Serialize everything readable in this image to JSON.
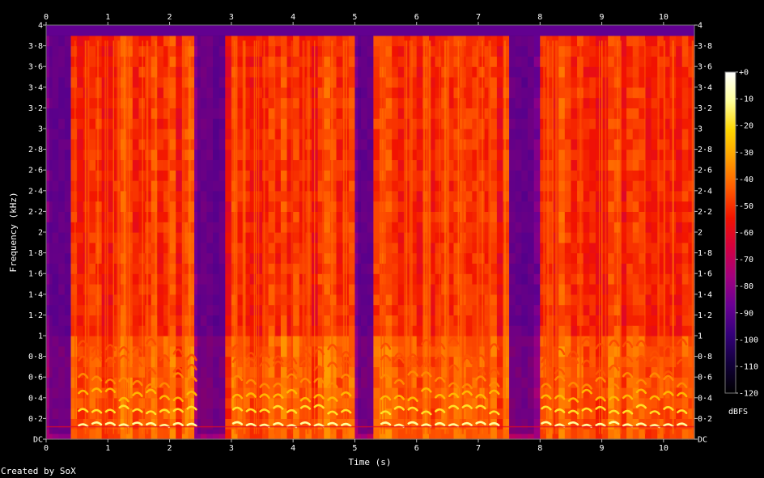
{
  "chart_data": {
    "type": "heatmap",
    "title": "",
    "xlabel": "Time (s)",
    "ylabel": "Frequency (kHz)",
    "xlim": [
      0,
      10.5
    ],
    "ylim": [
      0,
      4
    ],
    "x_ticks": [
      "0",
      "1",
      "2",
      "3",
      "4",
      "5",
      "6",
      "7",
      "8",
      "9",
      "10"
    ],
    "y_ticks": [
      "DC",
      "0·2",
      "0·4",
      "0·6",
      "0·8",
      "1",
      "1·2",
      "1·4",
      "1·6",
      "1·8",
      "2",
      "2·2",
      "2·4",
      "2·6",
      "2·8",
      "3",
      "3·2",
      "3·4",
      "3·6",
      "3·8",
      "4"
    ],
    "colorbar": {
      "label": "dBFS",
      "ticks": [
        "+0",
        "-10",
        "-20",
        "-30",
        "-40",
        "-50",
        "-60",
        "-70",
        "-80",
        "-90",
        "-100",
        "-110",
        "-120"
      ],
      "range": [
        -120,
        0
      ],
      "colors": [
        "#000000",
        "#12003a",
        "#34007a",
        "#6a0094",
        "#a3007e",
        "#d40040",
        "#f21300",
        "#ff5a00",
        "#ff9c00",
        "#ffd600",
        "#ffff9a",
        "#ffffff"
      ]
    },
    "silence_intervals_s": [
      [
        0,
        0.45
      ],
      [
        2.4,
        2.95
      ],
      [
        5.0,
        5.35
      ],
      [
        7.45,
        7.95
      ],
      [
        10.5,
        10.55
      ]
    ],
    "speech_segments_s": [
      [
        0.45,
        2.4
      ],
      [
        2.95,
        5.0
      ],
      [
        5.35,
        7.45
      ],
      [
        7.95,
        10.5
      ]
    ],
    "harmonic_fundamental_khz": 0.13,
    "max_visible_frequency_khz": 3.9
  },
  "footer": {
    "credit": "Created by SoX"
  }
}
